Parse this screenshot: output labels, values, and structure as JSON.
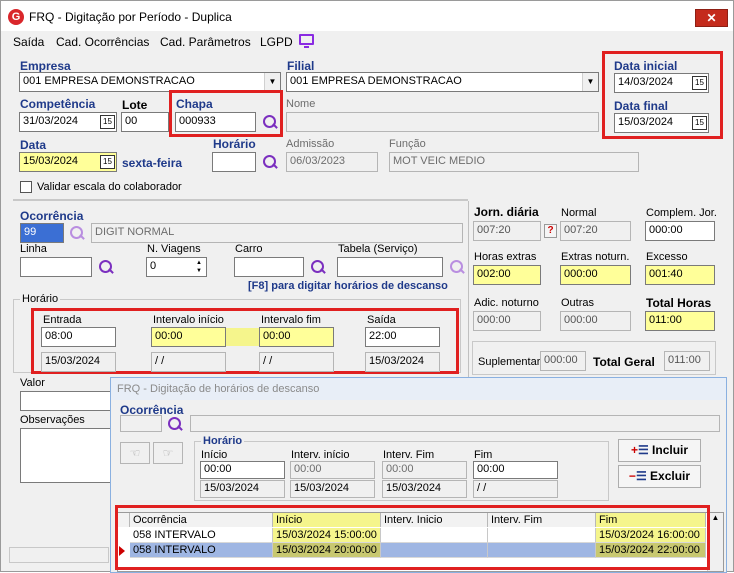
{
  "window": {
    "title": "FRQ - Digitação por Período - Duplica",
    "close": "✕"
  },
  "menu": [
    "Saída",
    "Cad. Ocorrências",
    "Cad. Parâmetros",
    "LGPD"
  ],
  "form": {
    "empresa_label": "Empresa",
    "empresa_value": "001 EMPRESA DEMONSTRACAO",
    "filial_label": "Filial",
    "filial_value": "001 EMPRESA DEMONSTRACAO",
    "data_inicial_label": "Data inicial",
    "data_inicial_value": "14/03/2024",
    "data_final_label": "Data final",
    "data_final_value": "15/03/2024",
    "competencia_label": "Competência",
    "competencia_value": "31/03/2024",
    "lote_label": "Lote",
    "lote_value": "00",
    "chapa_label": "Chapa",
    "chapa_value": "000933",
    "nome_label": "Nome",
    "nome_value": "",
    "data_label": "Data",
    "data_value": "15/03/2024",
    "weekday": "sexta-feira",
    "horario_label": "Horário",
    "horario_value": "",
    "admissao_label": "Admissão",
    "admissao_value": "06/03/2023",
    "funcao_label": "Função",
    "funcao_value": "MOT VEIC MEDIO",
    "validar_label": "Validar escala do colaborador",
    "ocorrencia_label": "Ocorrência",
    "ocorrencia_code": "99",
    "ocorrencia_desc": "DIGIT NORMAL",
    "linha_label": "Linha",
    "linha_value": "",
    "viagens_label": "N. Viagens",
    "viagens_value": "0",
    "carro_label": "Carro",
    "carro_value": "",
    "tabela_label": "Tabela (Serviço)",
    "tabela_value": "",
    "f8_hint": "[F8] para digitar horários de descanso",
    "horario_group": "Horário",
    "entrada_label": "Entrada",
    "entrada_value": "08:00",
    "entrada_date": "15/03/2024",
    "int_inicio_label": "Intervalo início",
    "int_inicio_value": "00:00",
    "int_inicio_date": "/ /",
    "int_fim_label": "Intervalo fim",
    "int_fim_value": "00:00",
    "int_fim_date": "/ /",
    "saida_label": "Saída",
    "saida_value": "22:00",
    "saida_date": "15/03/2024",
    "valor_label": "Valor",
    "observacoes_label": "Observações"
  },
  "totals": {
    "jorn_label": "Jorn. diária",
    "jorn_value": "007:20",
    "normal_label": "Normal",
    "normal_value": "007:20",
    "complem_label": "Complem. Jor.",
    "complem_value": "000:00",
    "horas_extras_label": "Horas extras",
    "horas_extras_value": "002:00",
    "extras_noturn_label": "Extras noturn.",
    "extras_noturn_value": "000:00",
    "excesso_label": "Excesso",
    "excesso_value": "001:40",
    "adic_noturno_label": "Adic. noturno",
    "adic_noturno_value": "000:00",
    "outras_label": "Outras",
    "outras_value": "000:00",
    "total_horas_label": "Total Horas",
    "total_horas_value": "011:00",
    "suplementar_label": "Suplementar",
    "suplementar_value": "000:00",
    "total_geral_label": "Total Geral",
    "total_geral_value": "011:00"
  },
  "dialog": {
    "title": "FRQ - Digitação de horários de descanso",
    "ocorrencia_label": "Ocorrência",
    "horario_group": "Horário",
    "inicio_label": "Início",
    "inicio_value": "00:00",
    "inicio_date": "15/03/2024",
    "interv_inicio_label": "Interv. início",
    "interv_inicio_value": "00:00",
    "interv_inicio_date": "15/03/2024",
    "interv_fim_label": "Interv. Fim",
    "interv_fim_value": "00:00",
    "interv_fim_date": "15/03/2024",
    "fim_label": "Fim",
    "fim_value": "00:00",
    "fim_date": "/ /",
    "incluir_label": "Incluir",
    "excluir_label": "Excluir",
    "grid_headers": [
      "Ocorrência",
      "Início",
      "Interv. Inicio",
      "Interv. Fim",
      "Fim"
    ],
    "rows": [
      [
        "058 INTERVALO",
        "15/03/2024 15:00:00",
        "",
        "",
        "15/03/2024 16:00:00"
      ],
      [
        "058 INTERVALO",
        "15/03/2024 20:00:00",
        "",
        "",
        "15/03/2024 22:00:00"
      ]
    ]
  }
}
